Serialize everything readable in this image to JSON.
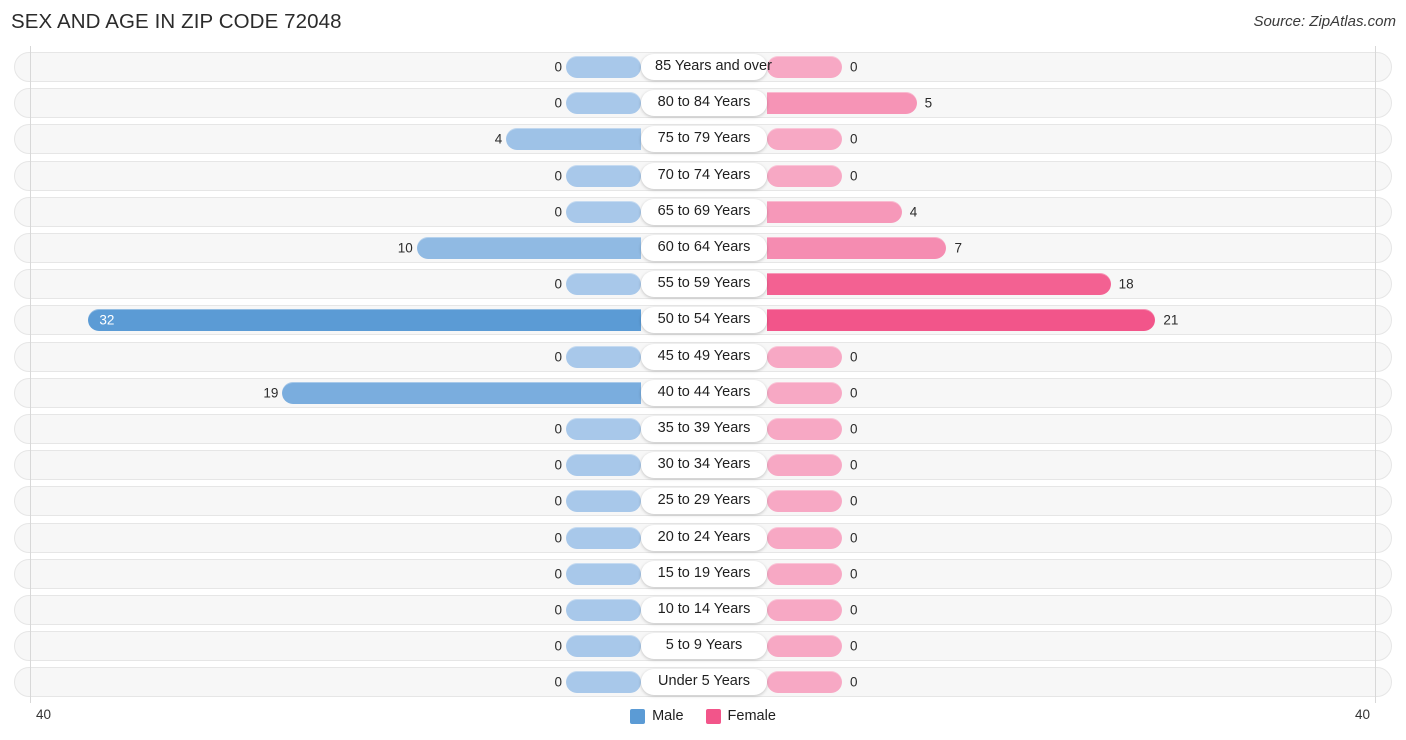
{
  "header": {
    "title": "SEX AND AGE IN ZIP CODE 72048",
    "source": "Source: ZipAtlas.com"
  },
  "axis": {
    "left_max": "40",
    "right_max": "40"
  },
  "legend": {
    "items": [
      {
        "label": "Male",
        "color": "#5b9bd5"
      },
      {
        "label": "Female",
        "color": "#f2558a"
      }
    ]
  },
  "colors": {
    "male_min": "#a8c8ea",
    "male_max": "#5b9bd5",
    "female_min": "#f7a8c4",
    "female_max": "#f2558a",
    "row_track": "#f7f7f7",
    "row_border": "#e6e6e6",
    "axis_line": "#d8d8d8"
  },
  "chart_data": {
    "type": "bar",
    "subtype": "population-pyramid",
    "title": "SEX AND AGE IN ZIP CODE 72048",
    "xlabel": "",
    "ylabel": "",
    "xlim": [
      40,
      40
    ],
    "axis_max": 40,
    "grid": false,
    "legend_position": "bottom-center",
    "categories": [
      "85 Years and over",
      "80 to 84 Years",
      "75 to 79 Years",
      "70 to 74 Years",
      "65 to 69 Years",
      "60 to 64 Years",
      "55 to 59 Years",
      "50 to 54 Years",
      "45 to 49 Years",
      "40 to 44 Years",
      "35 to 39 Years",
      "30 to 34 Years",
      "25 to 29 Years",
      "20 to 24 Years",
      "15 to 19 Years",
      "10 to 14 Years",
      "5 to 9 Years",
      "Under 5 Years"
    ],
    "series": [
      {
        "name": "Male",
        "values": [
          0,
          0,
          4,
          0,
          0,
          10,
          0,
          32,
          0,
          19,
          0,
          0,
          0,
          0,
          0,
          0,
          0,
          0
        ]
      },
      {
        "name": "Female",
        "values": [
          0,
          5,
          0,
          0,
          4,
          7,
          18,
          21,
          0,
          0,
          0,
          0,
          0,
          0,
          0,
          0,
          0,
          0
        ]
      }
    ],
    "rows": [
      {
        "age": "85 Years and over",
        "male": 0,
        "female": 0,
        "male_label": "0",
        "female_label": "0"
      },
      {
        "age": "80 to 84 Years",
        "male": 0,
        "female": 5,
        "male_label": "0",
        "female_label": "5"
      },
      {
        "age": "75 to 79 Years",
        "male": 4,
        "female": 0,
        "male_label": "4",
        "female_label": "0"
      },
      {
        "age": "70 to 74 Years",
        "male": 0,
        "female": 0,
        "male_label": "0",
        "female_label": "0"
      },
      {
        "age": "65 to 69 Years",
        "male": 0,
        "female": 4,
        "male_label": "0",
        "female_label": "4"
      },
      {
        "age": "60 to 64 Years",
        "male": 10,
        "female": 7,
        "male_label": "10",
        "female_label": "7"
      },
      {
        "age": "55 to 59 Years",
        "male": 0,
        "female": 18,
        "male_label": "0",
        "female_label": "18"
      },
      {
        "age": "50 to 54 Years",
        "male": 32,
        "female": 21,
        "male_label": "32",
        "female_label": "21"
      },
      {
        "age": "45 to 49 Years",
        "male": 0,
        "female": 0,
        "male_label": "0",
        "female_label": "0"
      },
      {
        "age": "40 to 44 Years",
        "male": 19,
        "female": 0,
        "male_label": "19",
        "female_label": "0"
      },
      {
        "age": "35 to 39 Years",
        "male": 0,
        "female": 0,
        "male_label": "0",
        "female_label": "0"
      },
      {
        "age": "30 to 34 Years",
        "male": 0,
        "female": 0,
        "male_label": "0",
        "female_label": "0"
      },
      {
        "age": "25 to 29 Years",
        "male": 0,
        "female": 0,
        "male_label": "0",
        "female_label": "0"
      },
      {
        "age": "20 to 24 Years",
        "male": 0,
        "female": 0,
        "male_label": "0",
        "female_label": "0"
      },
      {
        "age": "15 to 19 Years",
        "male": 0,
        "female": 0,
        "male_label": "0",
        "female_label": "0"
      },
      {
        "age": "10 to 14 Years",
        "male": 0,
        "female": 0,
        "male_label": "0",
        "female_label": "0"
      },
      {
        "age": "5 to 9 Years",
        "male": 0,
        "female": 0,
        "male_label": "0",
        "female_label": "0"
      },
      {
        "age": "Under 5 Years",
        "male": 0,
        "female": 0,
        "male_label": "0",
        "female_label": "0"
      }
    ]
  }
}
